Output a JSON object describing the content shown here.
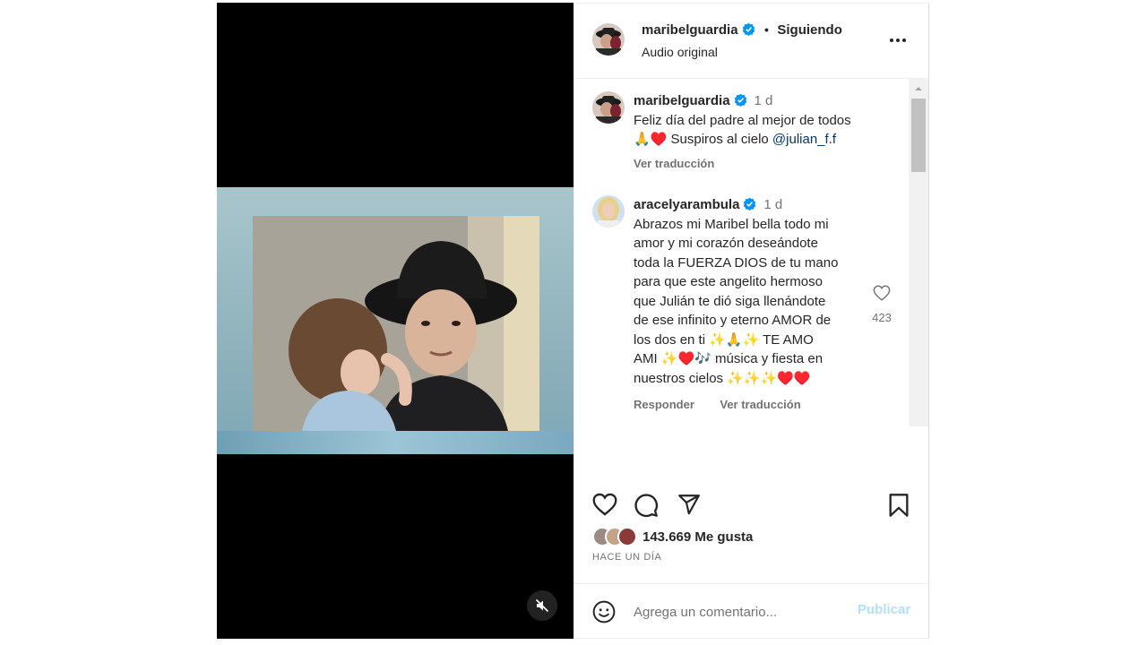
{
  "header": {
    "username": "maribelguardia",
    "separator": "•",
    "follow_status": "Siguiendo",
    "audio": "Audio original",
    "more_icon": "more-horizontal-icon"
  },
  "caption": {
    "username": "maribelguardia",
    "time": "1 d",
    "line1": "Feliz día del padre al mejor de todos",
    "line2_prefix": "🙏♥️ Suspiros al cielo ",
    "mention": "@julian_f.f",
    "translate": "Ver traducción"
  },
  "comment": {
    "username": "aracelyarambula",
    "time": "1 d",
    "lines": [
      "Abrazos mi Maribel bella todo mi",
      "amor y mi corazón deseándote",
      "toda la FUERZA DIOS de tu mano",
      "para que este angelito hermoso",
      "que Julián te dió siga llenándote",
      "de ese infinito y eterno AMOR de",
      "los dos en ti ✨🙏✨ TE AMO",
      "AMI ✨♥️🎶 música y fiesta en",
      "nuestros cielos ✨✨✨♥️♥️"
    ],
    "reply": "Responder",
    "translate": "Ver traducción",
    "like_count": "423"
  },
  "actions": {
    "likes": "143.669 Me gusta",
    "time_ago": "HACE UN DÍA"
  },
  "comment_bar": {
    "placeholder": "Agrega un comentario...",
    "publish": "Publicar"
  },
  "colors": {
    "verified": "#0095f6",
    "publish_disabled": "#b2dffc",
    "mention": "#00376b"
  }
}
